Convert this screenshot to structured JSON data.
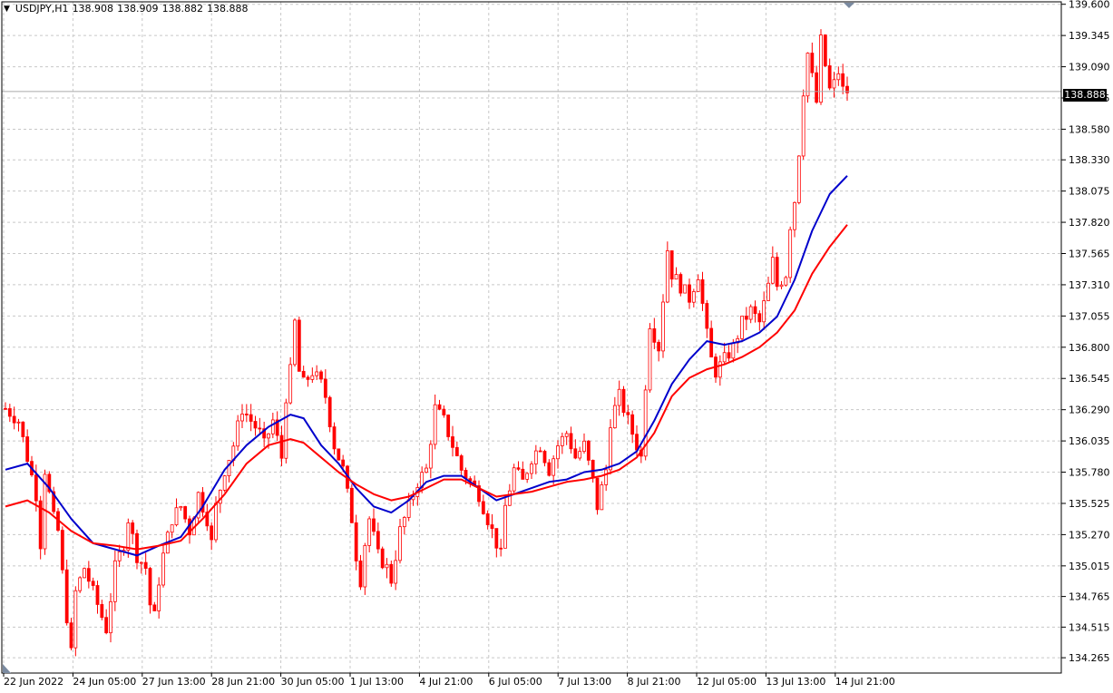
{
  "header": {
    "symbol_timeframe": "USDJPY,H1",
    "open": "138.908",
    "high": "138.909",
    "low": "138.882",
    "close": "138.888"
  },
  "current_price_label": "138.888",
  "colors": {
    "background": "#ffffff",
    "grid": "#c8c8c8",
    "candle": "#ff0000",
    "ma_fast": "#0000cc",
    "ma_slow": "#ff0000"
  },
  "chart_data": {
    "type": "line",
    "yticks": [
      "139.600",
      "139.345",
      "139.090",
      "138.835",
      "138.580",
      "138.330",
      "138.075",
      "137.820",
      "137.565",
      "137.310",
      "137.055",
      "136.800",
      "136.545",
      "136.290",
      "136.035",
      "135.780",
      "135.525",
      "135.270",
      "135.015",
      "134.765",
      "134.515",
      "134.265"
    ],
    "xticks": [
      "22 Jun 2022",
      "24 Jun 05:00",
      "27 Jun 13:00",
      "28 Jun 21:00",
      "30 Jun 05:00",
      "1 Jul 13:00",
      "4 Jul 21:00",
      "6 Jul 05:00",
      "7 Jul 13:00",
      "8 Jul 21:00",
      "12 Jul 05:00",
      "13 Jul 13:00",
      "14 Jul 21:00"
    ],
    "ylim": [
      134.14,
      139.62
    ],
    "grid": true,
    "price_path": [
      [
        0,
        136.3
      ],
      [
        3,
        136.2
      ],
      [
        5,
        135.9
      ],
      [
        7,
        135.6
      ],
      [
        8,
        135.2
      ],
      [
        9,
        135.8
      ],
      [
        11,
        135.4
      ],
      [
        12,
        135.3
      ],
      [
        14,
        134.6
      ],
      [
        15,
        134.3
      ],
      [
        16,
        134.8
      ],
      [
        18,
        135.0
      ],
      [
        20,
        134.8
      ],
      [
        22,
        134.6
      ],
      [
        23,
        134.5
      ],
      [
        25,
        135.0
      ],
      [
        27,
        135.2
      ],
      [
        28,
        135.4
      ],
      [
        30,
        135.1
      ],
      [
        32,
        135.0
      ],
      [
        33,
        134.7
      ],
      [
        34,
        134.6
      ],
      [
        35,
        134.9
      ],
      [
        36,
        135.1
      ],
      [
        38,
        135.4
      ],
      [
        40,
        135.5
      ],
      [
        42,
        135.3
      ],
      [
        44,
        135.6
      ],
      [
        46,
        135.4
      ],
      [
        47,
        135.2
      ],
      [
        48,
        135.5
      ],
      [
        50,
        135.8
      ],
      [
        52,
        136.0
      ],
      [
        54,
        136.3
      ],
      [
        56,
        136.2
      ],
      [
        58,
        136.1
      ],
      [
        59,
        136.0
      ],
      [
        61,
        136.2
      ],
      [
        63,
        135.9
      ],
      [
        64,
        136.4
      ],
      [
        65,
        136.6
      ],
      [
        66,
        137.0
      ],
      [
        67,
        136.6
      ],
      [
        68,
        136.5
      ],
      [
        70,
        136.6
      ],
      [
        72,
        136.5
      ],
      [
        73,
        136.4
      ],
      [
        74,
        136.2
      ],
      [
        75,
        136.0
      ],
      [
        77,
        135.8
      ],
      [
        78,
        135.6
      ],
      [
        79,
        135.4
      ],
      [
        80,
        135.1
      ],
      [
        81,
        134.9
      ],
      [
        82,
        135.2
      ],
      [
        83,
        135.4
      ],
      [
        85,
        135.1
      ],
      [
        87,
        135.0
      ],
      [
        88,
        134.9
      ],
      [
        90,
        135.3
      ],
      [
        92,
        135.5
      ],
      [
        94,
        135.7
      ],
      [
        96,
        135.8
      ],
      [
        98,
        136.3
      ],
      [
        100,
        136.2
      ],
      [
        102,
        136.0
      ],
      [
        104,
        135.8
      ],
      [
        106,
        135.7
      ],
      [
        108,
        135.6
      ],
      [
        110,
        135.4
      ],
      [
        112,
        135.2
      ],
      [
        113,
        135.1
      ],
      [
        114,
        135.5
      ],
      [
        116,
        135.8
      ],
      [
        118,
        135.7
      ],
      [
        120,
        135.9
      ],
      [
        122,
        136.0
      ],
      [
        124,
        135.8
      ],
      [
        126,
        136.0
      ],
      [
        128,
        136.1
      ],
      [
        130,
        135.9
      ],
      [
        132,
        136.0
      ],
      [
        134,
        135.7
      ],
      [
        135,
        135.5
      ],
      [
        137,
        135.8
      ],
      [
        138,
        136.2
      ],
      [
        140,
        136.4
      ],
      [
        142,
        136.2
      ],
      [
        144,
        136.0
      ],
      [
        145,
        135.9
      ],
      [
        146,
        136.5
      ],
      [
        147,
        137.0
      ],
      [
        148,
        136.9
      ],
      [
        149,
        136.8
      ],
      [
        150,
        137.2
      ],
      [
        151,
        137.6
      ],
      [
        152,
        137.4
      ],
      [
        154,
        137.3
      ],
      [
        156,
        137.2
      ],
      [
        158,
        137.4
      ],
      [
        160,
        136.9
      ],
      [
        161,
        136.7
      ],
      [
        162,
        136.6
      ],
      [
        164,
        136.7
      ],
      [
        166,
        136.8
      ],
      [
        168,
        137.0
      ],
      [
        170,
        137.1
      ],
      [
        172,
        137.0
      ],
      [
        174,
        137.3
      ],
      [
        175,
        137.5
      ],
      [
        176,
        137.3
      ],
      [
        178,
        137.4
      ],
      [
        179,
        137.8
      ],
      [
        180,
        138.0
      ],
      [
        181,
        138.4
      ],
      [
        182,
        138.9
      ],
      [
        183,
        139.2
      ],
      [
        184,
        139.0
      ],
      [
        185,
        138.8
      ],
      [
        186,
        139.3
      ],
      [
        187,
        139.1
      ],
      [
        188,
        138.9
      ],
      [
        189,
        138.95
      ],
      [
        190,
        139.05
      ],
      [
        191,
        138.9
      ],
      [
        192,
        138.89
      ]
    ],
    "series": [
      {
        "values": [
          [
            0,
            135.8
          ],
          [
            5,
            135.85
          ],
          [
            10,
            135.65
          ],
          [
            15,
            135.4
          ],
          [
            20,
            135.2
          ],
          [
            25,
            135.15
          ],
          [
            30,
            135.1
          ],
          [
            35,
            135.18
          ],
          [
            40,
            135.25
          ],
          [
            45,
            135.5
          ],
          [
            50,
            135.8
          ],
          [
            55,
            136.0
          ],
          [
            60,
            136.15
          ],
          [
            65,
            136.25
          ],
          [
            68,
            136.22
          ],
          [
            72,
            136.0
          ],
          [
            76,
            135.85
          ],
          [
            80,
            135.65
          ],
          [
            84,
            135.5
          ],
          [
            88,
            135.45
          ],
          [
            92,
            135.55
          ],
          [
            96,
            135.7
          ],
          [
            100,
            135.75
          ],
          [
            104,
            135.75
          ],
          [
            108,
            135.65
          ],
          [
            112,
            135.55
          ],
          [
            116,
            135.6
          ],
          [
            120,
            135.65
          ],
          [
            124,
            135.7
          ],
          [
            128,
            135.72
          ],
          [
            132,
            135.78
          ],
          [
            136,
            135.8
          ],
          [
            140,
            135.85
          ],
          [
            144,
            135.95
          ],
          [
            148,
            136.2
          ],
          [
            152,
            136.5
          ],
          [
            156,
            136.7
          ],
          [
            160,
            136.85
          ],
          [
            164,
            136.82
          ],
          [
            168,
            136.85
          ],
          [
            172,
            136.92
          ],
          [
            176,
            137.05
          ],
          [
            180,
            137.35
          ],
          [
            184,
            137.75
          ],
          [
            188,
            138.05
          ],
          [
            192,
            138.2
          ]
        ]
      },
      {
        "values": [
          [
            0,
            135.5
          ],
          [
            5,
            135.55
          ],
          [
            10,
            135.45
          ],
          [
            15,
            135.3
          ],
          [
            20,
            135.2
          ],
          [
            25,
            135.18
          ],
          [
            30,
            135.15
          ],
          [
            35,
            135.18
          ],
          [
            40,
            135.22
          ],
          [
            45,
            135.4
          ],
          [
            50,
            135.6
          ],
          [
            55,
            135.85
          ],
          [
            60,
            136.0
          ],
          [
            65,
            136.05
          ],
          [
            68,
            136.02
          ],
          [
            72,
            135.9
          ],
          [
            76,
            135.78
          ],
          [
            80,
            135.68
          ],
          [
            84,
            135.6
          ],
          [
            88,
            135.55
          ],
          [
            92,
            135.58
          ],
          [
            96,
            135.65
          ],
          [
            100,
            135.72
          ],
          [
            104,
            135.72
          ],
          [
            108,
            135.65
          ],
          [
            112,
            135.58
          ],
          [
            116,
            135.6
          ],
          [
            120,
            135.62
          ],
          [
            124,
            135.66
          ],
          [
            128,
            135.7
          ],
          [
            132,
            135.72
          ],
          [
            136,
            135.75
          ],
          [
            140,
            135.8
          ],
          [
            144,
            135.9
          ],
          [
            148,
            136.1
          ],
          [
            152,
            136.4
          ],
          [
            156,
            136.55
          ],
          [
            160,
            136.62
          ],
          [
            164,
            136.66
          ],
          [
            168,
            136.72
          ],
          [
            172,
            136.8
          ],
          [
            176,
            136.92
          ],
          [
            180,
            137.1
          ],
          [
            184,
            137.4
          ],
          [
            188,
            137.62
          ],
          [
            192,
            137.8
          ]
        ]
      }
    ]
  }
}
